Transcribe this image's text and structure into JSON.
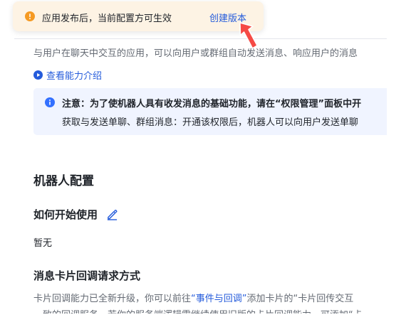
{
  "toast": {
    "message": "应用发布后，当前配置方可生效",
    "action_label": "创建版本",
    "icon": "warning-circle-icon",
    "color": "#f59a23"
  },
  "intro": {
    "description": "与用户在聊天中交互的应用，可以向用户或群组自动发送消息、响应用户的消息",
    "capability_link": "查看能力介绍"
  },
  "notice": {
    "label": "注意：",
    "line1_bold": "为了使机器人具有收发消息的基础功能，请在“权限管理”面板中开",
    "line2": "获取与发送单聊、群组消息：开通该权限后，机器人可以向用户发送单聊",
    "icon": "info-icon",
    "color": "#3370ff"
  },
  "robot_config": {
    "title": "机器人配置",
    "how_to_use": {
      "title": "如何开始使用",
      "value": "暂无"
    },
    "card_callback": {
      "title": "消息卡片回调请求方式",
      "desc_before_link": "卡片回调能力已全新升级，你可以前往",
      "link": "“事件与回调”",
      "desc_after_link": "添加卡片的“卡片回传交互",
      "desc_line2": "一致的回调服务。若你的服务端逻辑需继续使用旧版的卡片回调能力，可添加“卡"
    }
  },
  "colors": {
    "link": "#245bdb",
    "toast_bg": "#fdf3e4",
    "notice_bg": "#f0f4ff",
    "pointer": "#f54a45"
  }
}
